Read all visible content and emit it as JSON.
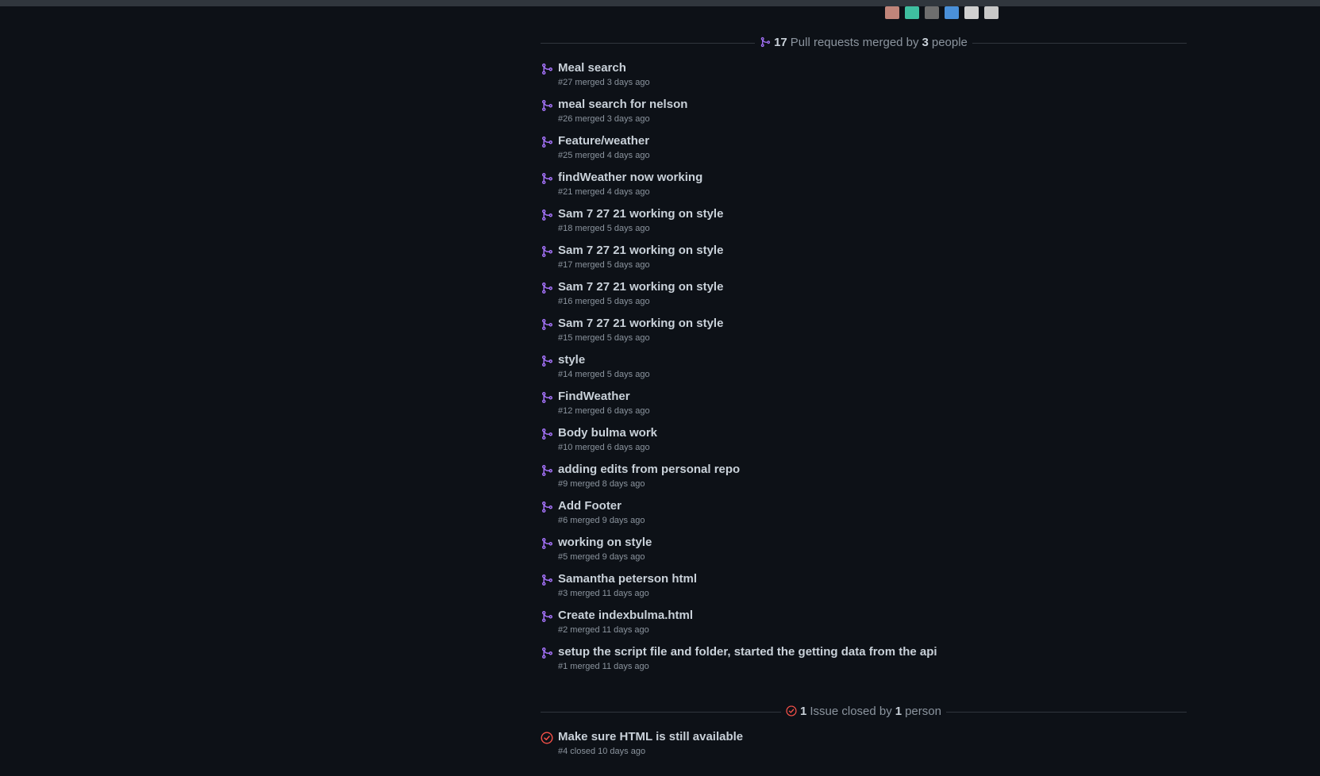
{
  "avatar_colors": [
    "#c0857a",
    "#3fbfa0",
    "#6e6e6e",
    "#4a90d9",
    "#d0d0d0",
    "#c8c8c8"
  ],
  "colors": {
    "merged_icon": "#a371f7",
    "closed_icon": "#f85149",
    "background": "#0d1117",
    "muted": "#8b949e",
    "text": "#c9d1d9"
  },
  "pr_summary": {
    "count": "17",
    "text_mid": "Pull requests merged by",
    "people": "3",
    "text_end": "people"
  },
  "pull_requests": [
    {
      "title": "Meal search",
      "meta": "#27 merged 3 days ago",
      "icon": "git-merge-icon"
    },
    {
      "title": "meal search for nelson",
      "meta": "#26 merged 3 days ago",
      "icon": "git-merge-icon"
    },
    {
      "title": "Feature/weather",
      "meta": "#25 merged 4 days ago",
      "icon": "git-merge-icon"
    },
    {
      "title": "findWeather now working",
      "meta": "#21 merged 4 days ago",
      "icon": "git-merge-icon"
    },
    {
      "title": "Sam 7 27 21 working on style",
      "meta": "#18 merged 5 days ago",
      "icon": "git-merge-icon"
    },
    {
      "title": "Sam 7 27 21 working on style",
      "meta": "#17 merged 5 days ago",
      "icon": "git-merge-icon"
    },
    {
      "title": "Sam 7 27 21 working on style",
      "meta": "#16 merged 5 days ago",
      "icon": "git-merge-icon"
    },
    {
      "title": "Sam 7 27 21 working on style",
      "meta": "#15 merged 5 days ago",
      "icon": "git-merge-icon"
    },
    {
      "title": "style",
      "meta": "#14 merged 5 days ago",
      "icon": "git-merge-icon"
    },
    {
      "title": "FindWeather",
      "meta": "#12 merged 6 days ago",
      "icon": "git-merge-icon"
    },
    {
      "title": "Body bulma work",
      "meta": "#10 merged 6 days ago",
      "icon": "git-merge-icon"
    },
    {
      "title": "adding edits from personal repo",
      "meta": "#9 merged 8 days ago",
      "icon": "git-merge-icon"
    },
    {
      "title": "Add Footer",
      "meta": "#6 merged 9 days ago",
      "icon": "git-merge-icon"
    },
    {
      "title": "working on style",
      "meta": "#5 merged 9 days ago",
      "icon": "git-merge-icon"
    },
    {
      "title": "Samantha peterson html",
      "meta": "#3 merged 11 days ago",
      "icon": "git-merge-icon"
    },
    {
      "title": "Create indexbulma.html",
      "meta": "#2 merged 11 days ago",
      "icon": "git-merge-icon"
    },
    {
      "title": "setup the script file and folder, started the getting data from the api",
      "meta": "#1 merged 11 days ago",
      "icon": "git-merge-icon"
    }
  ],
  "issue_summary": {
    "count": "1",
    "text_mid": "Issue closed by",
    "people": "1",
    "text_end": "person"
  },
  "issues": [
    {
      "title": "Make sure HTML is still available",
      "meta": "#4 closed 10 days ago",
      "icon": "issue-closed-icon"
    }
  ]
}
